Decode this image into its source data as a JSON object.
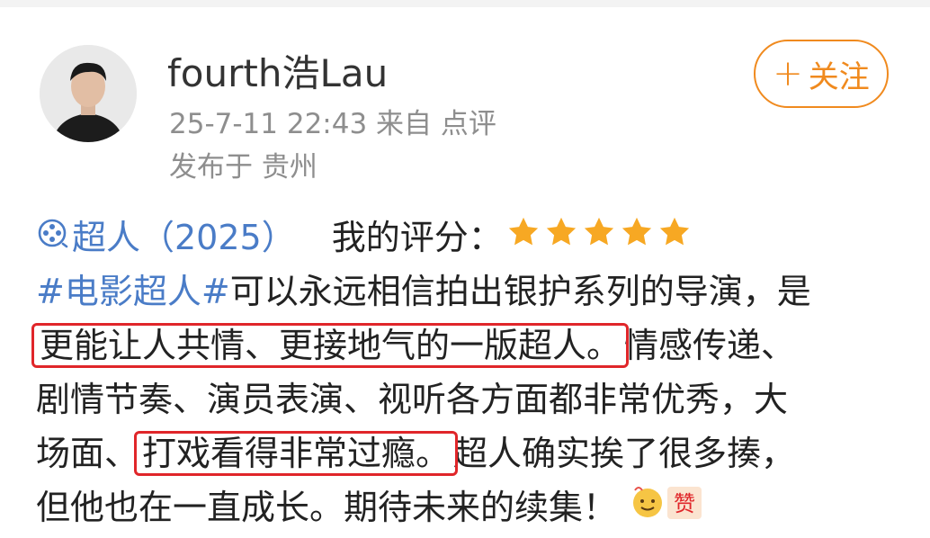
{
  "user": {
    "name": "fourth浩Lau",
    "meta_line": "25-7-11 22:43  来自 点评",
    "location": "发布于 贵州"
  },
  "follow_button": {
    "plus": "+",
    "label": "关注"
  },
  "review": {
    "movie_title": "超人（2025）",
    "rating_label": "我的评分：",
    "rating": 5,
    "star_color": "#f7a823"
  },
  "post": {
    "hashtag": "#电影超人#",
    "l1_rest": "可以永远相信拍出银护系列的导演，是",
    "l2_highlight": "更能让人共情、更接地气的一版超人。",
    "l2_rest": "情感传递、",
    "l3": "剧情节奏、演员表演、视听各方面都非常优秀，大",
    "l4_pre": "场面、",
    "l4_highlight": "打戏看得非常过瘾。",
    "l4_rest": "超人确实挨了很多揍，",
    "l5": "但他也在一直成长。期待未来的续集！",
    "sticker_label": "赞"
  },
  "colors": {
    "link": "#4a7cc7",
    "accent_orange": "#f08a1e",
    "highlight_box": "#e0262a",
    "meta_gray": "#8e8e8e"
  }
}
